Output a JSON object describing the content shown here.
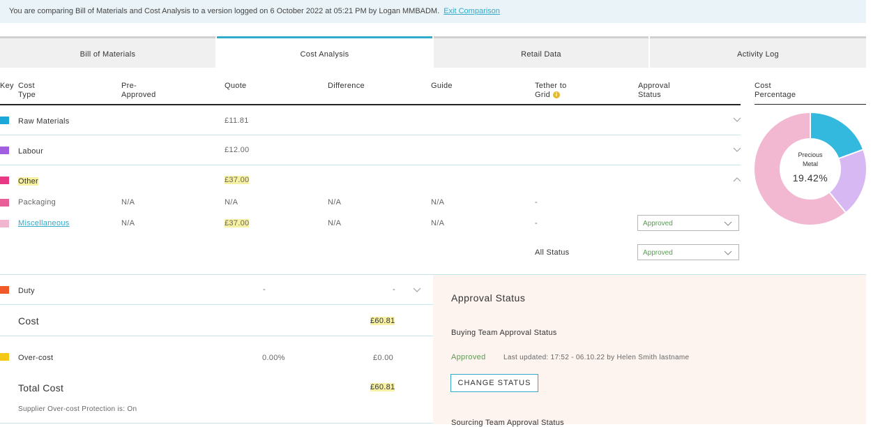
{
  "banner": {
    "text": "You are comparing Bill of Materials and Cost Analysis to a version logged on 6 October 2022 at 05:21 PM by Logan MMBADM.",
    "exit_link": "Exit Comparison"
  },
  "tabs": [
    {
      "label": "Bill of Materials",
      "active": false
    },
    {
      "label": "Cost Analysis",
      "active": true
    },
    {
      "label": "Retail Data",
      "active": false
    },
    {
      "label": "Activity Log",
      "active": false
    }
  ],
  "table": {
    "headers": {
      "key": "Key",
      "cost_type_1": "Cost",
      "cost_type_2": "Type",
      "pre_approved_1": "Pre-",
      "pre_approved_2": "Approved",
      "quote": "Quote",
      "difference": "Difference",
      "guide": "Guide",
      "tether_1": "Tether to",
      "tether_2": "Grid",
      "tether_info": "i",
      "approval_1": "Approval",
      "approval_2": "Status",
      "cost_pct_1": "Cost",
      "cost_pct_2": "Percentage"
    },
    "rows": {
      "raw_materials": {
        "name": "Raw Materials",
        "quote": "£11.81",
        "color": "#1ba8d8"
      },
      "labour": {
        "name": "Labour",
        "quote": "£12.00",
        "color": "#a25ee0"
      },
      "other": {
        "name": "Other",
        "quote": "£37.00",
        "color": "#e83a84"
      },
      "packaging": {
        "name": "Packaging",
        "pre_approved": "N/A",
        "quote": "N/A",
        "difference": "N/A",
        "guide": "N/A",
        "tether": "-",
        "color": "#e85e96"
      },
      "miscellaneous": {
        "name": "Miscellaneous",
        "pre_approved": "N/A",
        "quote": "£37.00",
        "difference": "N/A",
        "guide": "N/A",
        "tether": "-",
        "approval": "Approved",
        "color": "#f1b5cf"
      },
      "all_status": {
        "label": "All Status",
        "approval": "Approved"
      },
      "duty": {
        "name": "Duty",
        "col_a": "-",
        "col_b": "-",
        "color": "#f05a28"
      },
      "cost": {
        "name": "Cost",
        "value": "£60.81"
      },
      "over_cost": {
        "name": "Over-cost",
        "percent": "0.00%",
        "value": "£0.00",
        "color": "#f5c817"
      },
      "total_cost": {
        "name": "Total Cost",
        "value": "£60.81"
      },
      "protection": "Supplier Over-cost Protection is: On"
    }
  },
  "donut": {
    "center_label": "Precious Metal",
    "center_label_1": "Precious",
    "center_label_2": "Metal",
    "center_value": "19.42%",
    "segments": [
      {
        "name": "Raw Materials",
        "color": "#33b8de",
        "value": 19.42
      },
      {
        "name": "Labour",
        "color": "#d7b8f2",
        "value": 19.73
      },
      {
        "name": "Other",
        "color": "#f2b8d1",
        "value": 60.85
      }
    ]
  },
  "approval_panel": {
    "title": "Approval Status",
    "buying_title": "Buying Team Approval Status",
    "buying_status": "Approved",
    "buying_updated": "Last updated: 17:52 - 06.10.22 by Helen Smith lastname",
    "change_status": "CHANGE STATUS",
    "sourcing_title": "Sourcing Team Approval Status"
  }
}
